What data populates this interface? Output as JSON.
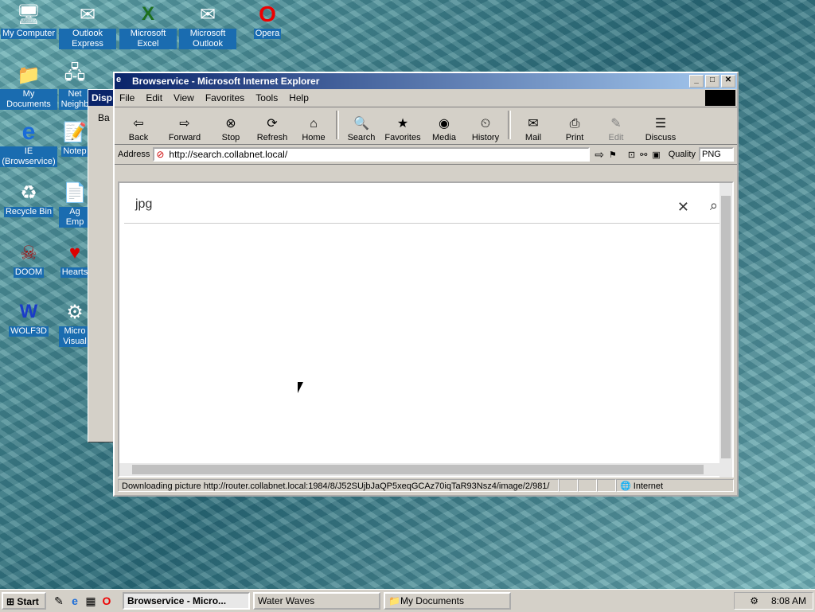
{
  "desktop": {
    "icons": [
      {
        "label": "My Computer",
        "glyph": "🖥"
      },
      {
        "label": "Outlook Express",
        "glyph": "✉"
      },
      {
        "label": "Microsoft Excel",
        "glyph": "X"
      },
      {
        "label": "Microsoft Outlook",
        "glyph": "✉"
      },
      {
        "label": "Opera",
        "glyph": "O"
      },
      {
        "label": "My Documents",
        "glyph": "📁"
      },
      {
        "label": "Net Neighb",
        "glyph": "🖧"
      },
      {
        "label": "IE (Browservice)",
        "glyph": "e"
      },
      {
        "label": "Notep",
        "glyph": "📝"
      },
      {
        "label": "Recycle Bin",
        "glyph": "♻"
      },
      {
        "label": "Ag Emp",
        "glyph": "📄"
      },
      {
        "label": "DOOM",
        "glyph": "☠"
      },
      {
        "label": "Hearts",
        "glyph": "♥"
      },
      {
        "label": "WOLF3D",
        "glyph": "W"
      },
      {
        "label": "Micro Visual",
        "glyph": "⚙"
      }
    ],
    "bg_window_title": "Disp",
    "bg_window_tab": "Ba"
  },
  "window": {
    "title": "Browservice - Microsoft Internet Explorer",
    "menu": [
      "File",
      "Edit",
      "View",
      "Favorites",
      "Tools",
      "Help"
    ],
    "toolbar": [
      {
        "label": "Back",
        "icon": "⇦"
      },
      {
        "label": "Forward",
        "icon": "⇨"
      },
      {
        "label": "Stop",
        "icon": "⊗"
      },
      {
        "label": "Refresh",
        "icon": "⟳"
      },
      {
        "label": "Home",
        "icon": "⌂"
      },
      {
        "label": "Search",
        "icon": "🔍"
      },
      {
        "label": "Favorites",
        "icon": "★"
      },
      {
        "label": "Media",
        "icon": "◉"
      },
      {
        "label": "History",
        "icon": "⏲"
      },
      {
        "label": "Mail",
        "icon": "✉"
      },
      {
        "label": "Print",
        "icon": "⎙"
      },
      {
        "label": "Edit",
        "icon": "✎"
      },
      {
        "label": "Discuss",
        "icon": "☰"
      }
    ],
    "address_label": "Address",
    "address_url": "http://search.collabnet.local/",
    "quality_label": "Quality",
    "quality_value": "PNG",
    "search_query": "jpg",
    "status_text": "Downloading picture http://router.collabnet.local:1984/8/J52SUjbJaQP5xeqGCAz70iqTaR93Nsz4/image/2/981/",
    "status_zone": "Internet"
  },
  "taskbar": {
    "start_label": "Start",
    "tasks": [
      "Browservice - Micro...",
      "Water Waves",
      "My Documents"
    ],
    "clock": "8:08 AM"
  }
}
